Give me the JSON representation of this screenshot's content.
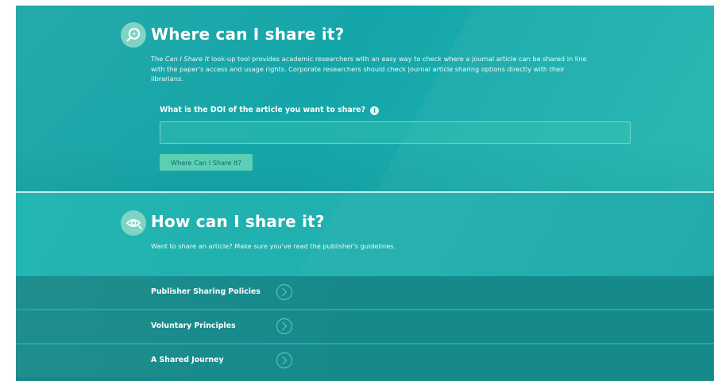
{
  "share_section": {
    "title": "Where can I share it?",
    "intro_prefix": "The ",
    "intro_tool_name": "Can I Share It",
    "intro_suffix": " look-up tool provides academic researchers with an easy way to check where a journal article can be shared in line with the paper's access and usage rights. Corporate researchers should check journal article sharing options directly with their librarians.",
    "doi_label": "What is the DOI of the article you want to share?",
    "doi_value": "",
    "submit_label": "Where Can I Share It?"
  },
  "how_section": {
    "title": "How can I share it?",
    "intro": "Want to share an article? Make sure you've read the publisher's guidelines."
  },
  "links": [
    {
      "label": "Publisher Sharing Policies"
    },
    {
      "label": "Voluntary Principles"
    },
    {
      "label": "A Shared Journey"
    }
  ],
  "icons": {
    "search": "magnifier-icon",
    "eye": "eye-icon",
    "info": "info-icon",
    "chevron": "chevron-right-circle-icon"
  },
  "colors": {
    "teal_primary": "#1aa5a7",
    "teal_light_icon": "#7fd4c6",
    "button_green": "#5cd0b5",
    "link_row_bg": "#16898a",
    "text_white": "#ffffff"
  }
}
